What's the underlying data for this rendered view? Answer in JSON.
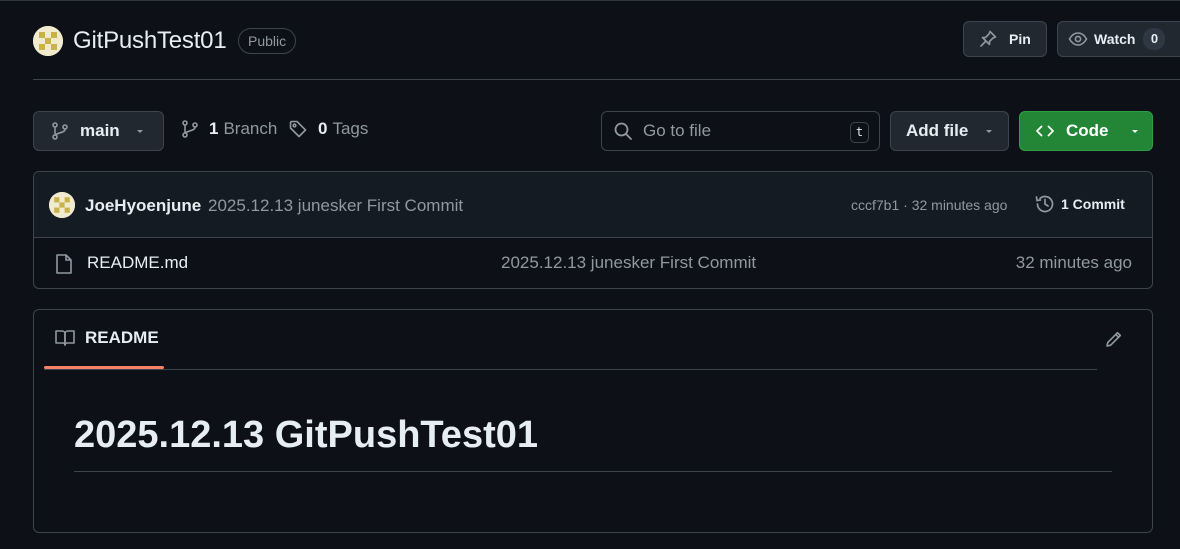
{
  "repo": {
    "name": "GitPushTest01",
    "visibility": "Public",
    "pin_label": "Pin",
    "watch_label": "Watch",
    "watch_count": "0"
  },
  "toolbar": {
    "branch": "main",
    "branch_count": "1",
    "branch_label": "Branch",
    "tag_count": "0",
    "tag_label": "Tags",
    "search_placeholder": "Go to file",
    "search_shortcut": "t",
    "add_file_label": "Add file",
    "code_label": "Code"
  },
  "latest_commit": {
    "author": "JoeHyoenjune",
    "message": "2025.12.13 junesker First Commit",
    "hash_time": "cccf7b1 · 32 minutes ago",
    "commit_count_label": "1 Commit"
  },
  "files": [
    {
      "name": "README.md",
      "message": "2025.12.13 junesker First Commit",
      "time": "32 minutes ago"
    }
  ],
  "readme": {
    "tab_label": "README",
    "heading": "2025.12.13 GitPushTest01"
  },
  "colors": {
    "background": "#0d1117",
    "code_button": "#238636",
    "tab_underline": "#f78166",
    "border": "#3d444d"
  }
}
